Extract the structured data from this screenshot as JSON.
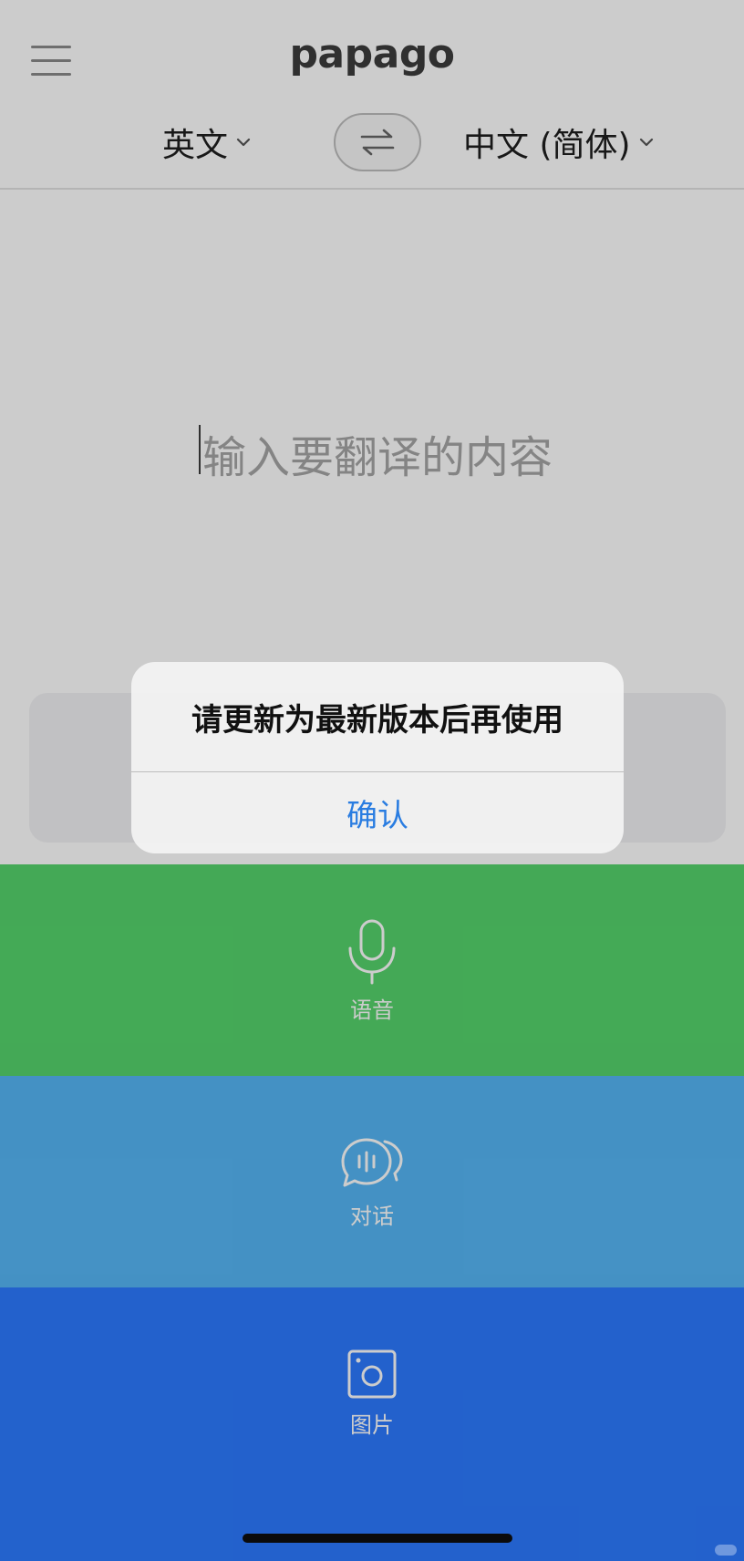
{
  "header": {
    "logo": "papago",
    "source_language": "英文",
    "target_language": "中文 (简体)"
  },
  "input": {
    "placeholder": "输入要翻译的内容"
  },
  "actions": [
    {
      "label": "语音",
      "icon": "microphone-icon",
      "color": "#55d46c"
    },
    {
      "label": "对话",
      "icon": "conversation-icon",
      "color": "#56b6f6"
    },
    {
      "label": "图片",
      "icon": "camera-icon",
      "color": "#2c7aff"
    }
  ],
  "alert": {
    "message": "请更新为最新版本后再使用",
    "confirm_label": "确认"
  }
}
